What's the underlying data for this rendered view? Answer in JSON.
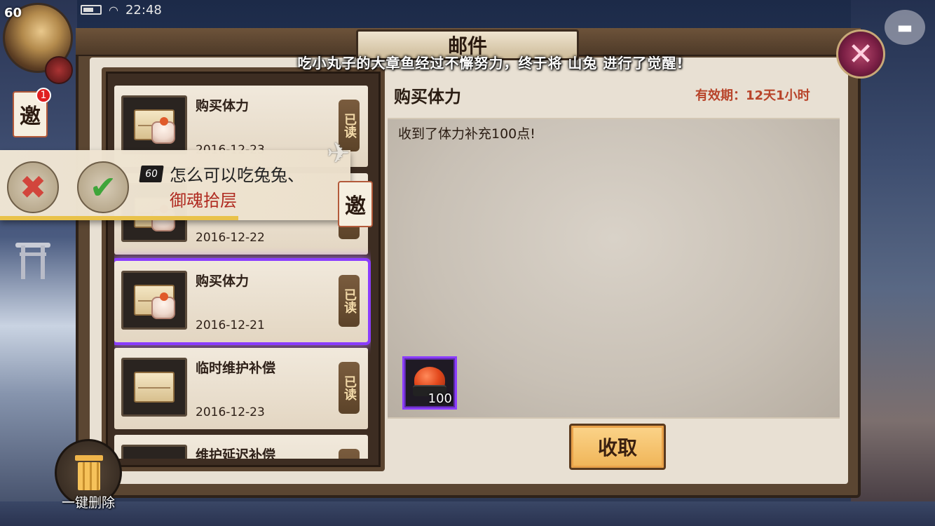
{
  "status_bar": {
    "time": "22:48"
  },
  "player": {
    "level": "60"
  },
  "left_invite": {
    "glyph": "邀",
    "badge": "1"
  },
  "window": {
    "title": "邮件",
    "notice": "吃小丸子的大章鱼经过不懈努力，终于将 山兔 进行了觉醒!"
  },
  "mail_list": [
    {
      "title": "购买体力",
      "date": "2016-12-23",
      "status": "已读",
      "icon": "envelope-gift-icon"
    },
    {
      "title": "",
      "date": "2016-12-22",
      "status": "",
      "icon": "envelope-gift-icon"
    },
    {
      "title": "购买体力",
      "date": "2016-12-21",
      "status": "已读",
      "icon": "envelope-gift-icon",
      "selected": true
    },
    {
      "title": "临时维护补偿",
      "date": "2016-12-23",
      "status": "已读",
      "icon": "envelope-icon"
    },
    {
      "title": "维护延迟补偿",
      "date": "",
      "status": "",
      "icon": "envelope-icon"
    }
  ],
  "invite_popup": {
    "level": "60",
    "name": "怎么可以吃兔兔、",
    "dungeon": "御魂拾层",
    "tag": "邀",
    "progress": 0.68
  },
  "detail": {
    "title": "购买体力",
    "expiry": "有效期：12天1小时",
    "body": "收到了体力补充100点!",
    "reward": {
      "icon": "sushi-icon",
      "quantity": "100"
    },
    "claim_label": "收取"
  },
  "delete_all_label": "一键删除",
  "colors": {
    "accent_purple": "#8a3cff",
    "expiry_red": "#b8442a",
    "dungeon_red": "#b02a20",
    "claim_gold": "#f0b457"
  }
}
